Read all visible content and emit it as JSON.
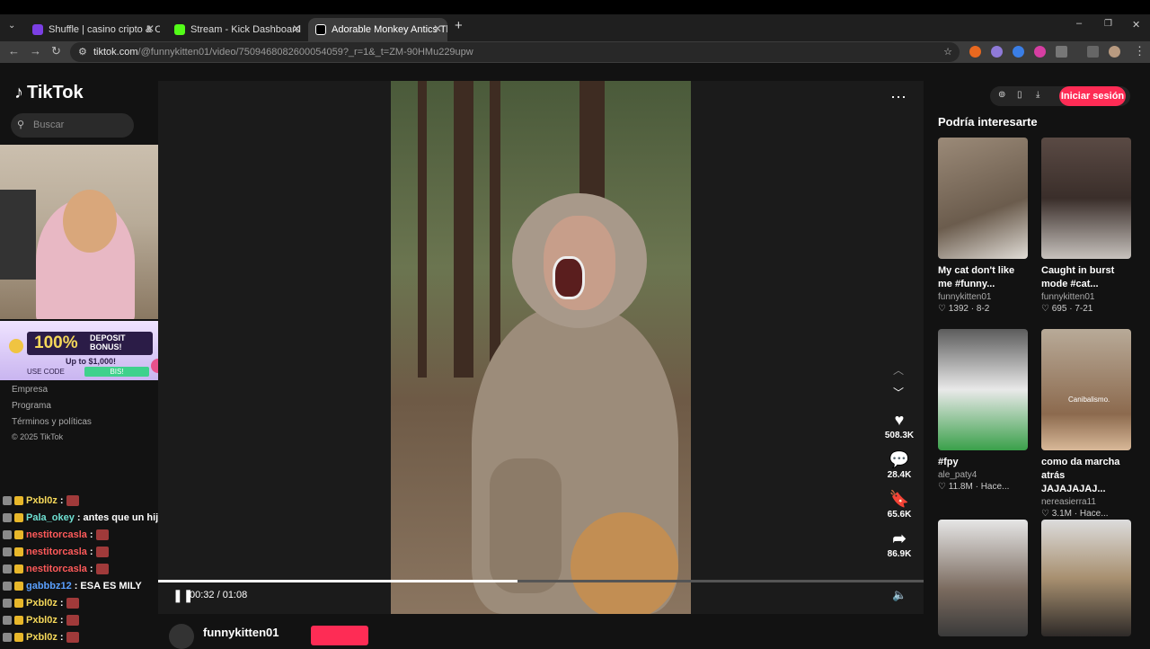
{
  "browser": {
    "tabs": [
      {
        "title": "Shuffle | casino cripto & Ca",
        "color": "#7b3fe4",
        "active": false
      },
      {
        "title": "Stream - Kick Dashboard",
        "color": "#53fc18",
        "active": false
      },
      {
        "title": "Adorable Monkey Antics Th",
        "color": "#ffffff",
        "active": true
      }
    ],
    "new_tab": "+",
    "url_host": "tiktok.com",
    "url_path": "/@funnykitten01/video/7509468082600054059?_r=1&_t=ZM-90HMu229upw"
  },
  "sidebar": {
    "logo": "TikTok",
    "search_placeholder": "Buscar",
    "footer_links": [
      "Empresa",
      "Programa",
      "Términos y políticas"
    ],
    "copyright": "© 2025 TikTok"
  },
  "promo": {
    "big_text": "100%",
    "bonus_line1": "DEPOSIT",
    "bonus_line2": "BONUS!",
    "upto": "Up to $1,000!",
    "use_code": "USE CODE",
    "code": "BIS!"
  },
  "chat": [
    {
      "user": "Pxbl0z",
      "color": "#f5d85a",
      "message": ""
    },
    {
      "user": "Pala_okey",
      "color": "#6fe0d2",
      "message": "antes que un hijoo"
    },
    {
      "user": "nestitorcasla",
      "color": "#ff5a5a",
      "message": ""
    },
    {
      "user": "nestitorcasla",
      "color": "#ff5a5a",
      "message": ""
    },
    {
      "user": "nestitorcasla",
      "color": "#ff5a5a",
      "message": ""
    },
    {
      "user": "gabbbz12",
      "color": "#5aa0ff",
      "message": "ESA ES MILY"
    },
    {
      "user": "Pxbl0z",
      "color": "#f5d85a",
      "message": ""
    },
    {
      "user": "Pxbl0z",
      "color": "#f5d85a",
      "message": ""
    },
    {
      "user": "Pxbl0z",
      "color": "#f5d85a",
      "message": ""
    }
  ],
  "video": {
    "likes": "508.3K",
    "comments": "28.4K",
    "saves": "65.6K",
    "shares": "86.9K",
    "time": "00:32 / 01:08",
    "progress": 0.47,
    "author": "funnykitten01"
  },
  "header": {
    "login": "Iniciar sesión"
  },
  "suggestions": {
    "title": "Podría interesarte",
    "items": [
      {
        "caption": "My cat don't like me #funny...",
        "author": "funnykitten01",
        "likes": "1392",
        "date": "8-2"
      },
      {
        "caption": "Caught in burst mode #cat...",
        "author": "funnykitten01",
        "likes": "695",
        "date": "7-21"
      },
      {
        "caption": "#fpy",
        "author": "ale_paty4",
        "likes": "11.8M",
        "date": "Hace..."
      },
      {
        "caption": "como da marcha atrás JAJAJAJAJ...",
        "author": "nereasierra11",
        "likes": "3.1M",
        "date": "Hace..."
      }
    ],
    "overlay_text": "Canibalismo."
  }
}
